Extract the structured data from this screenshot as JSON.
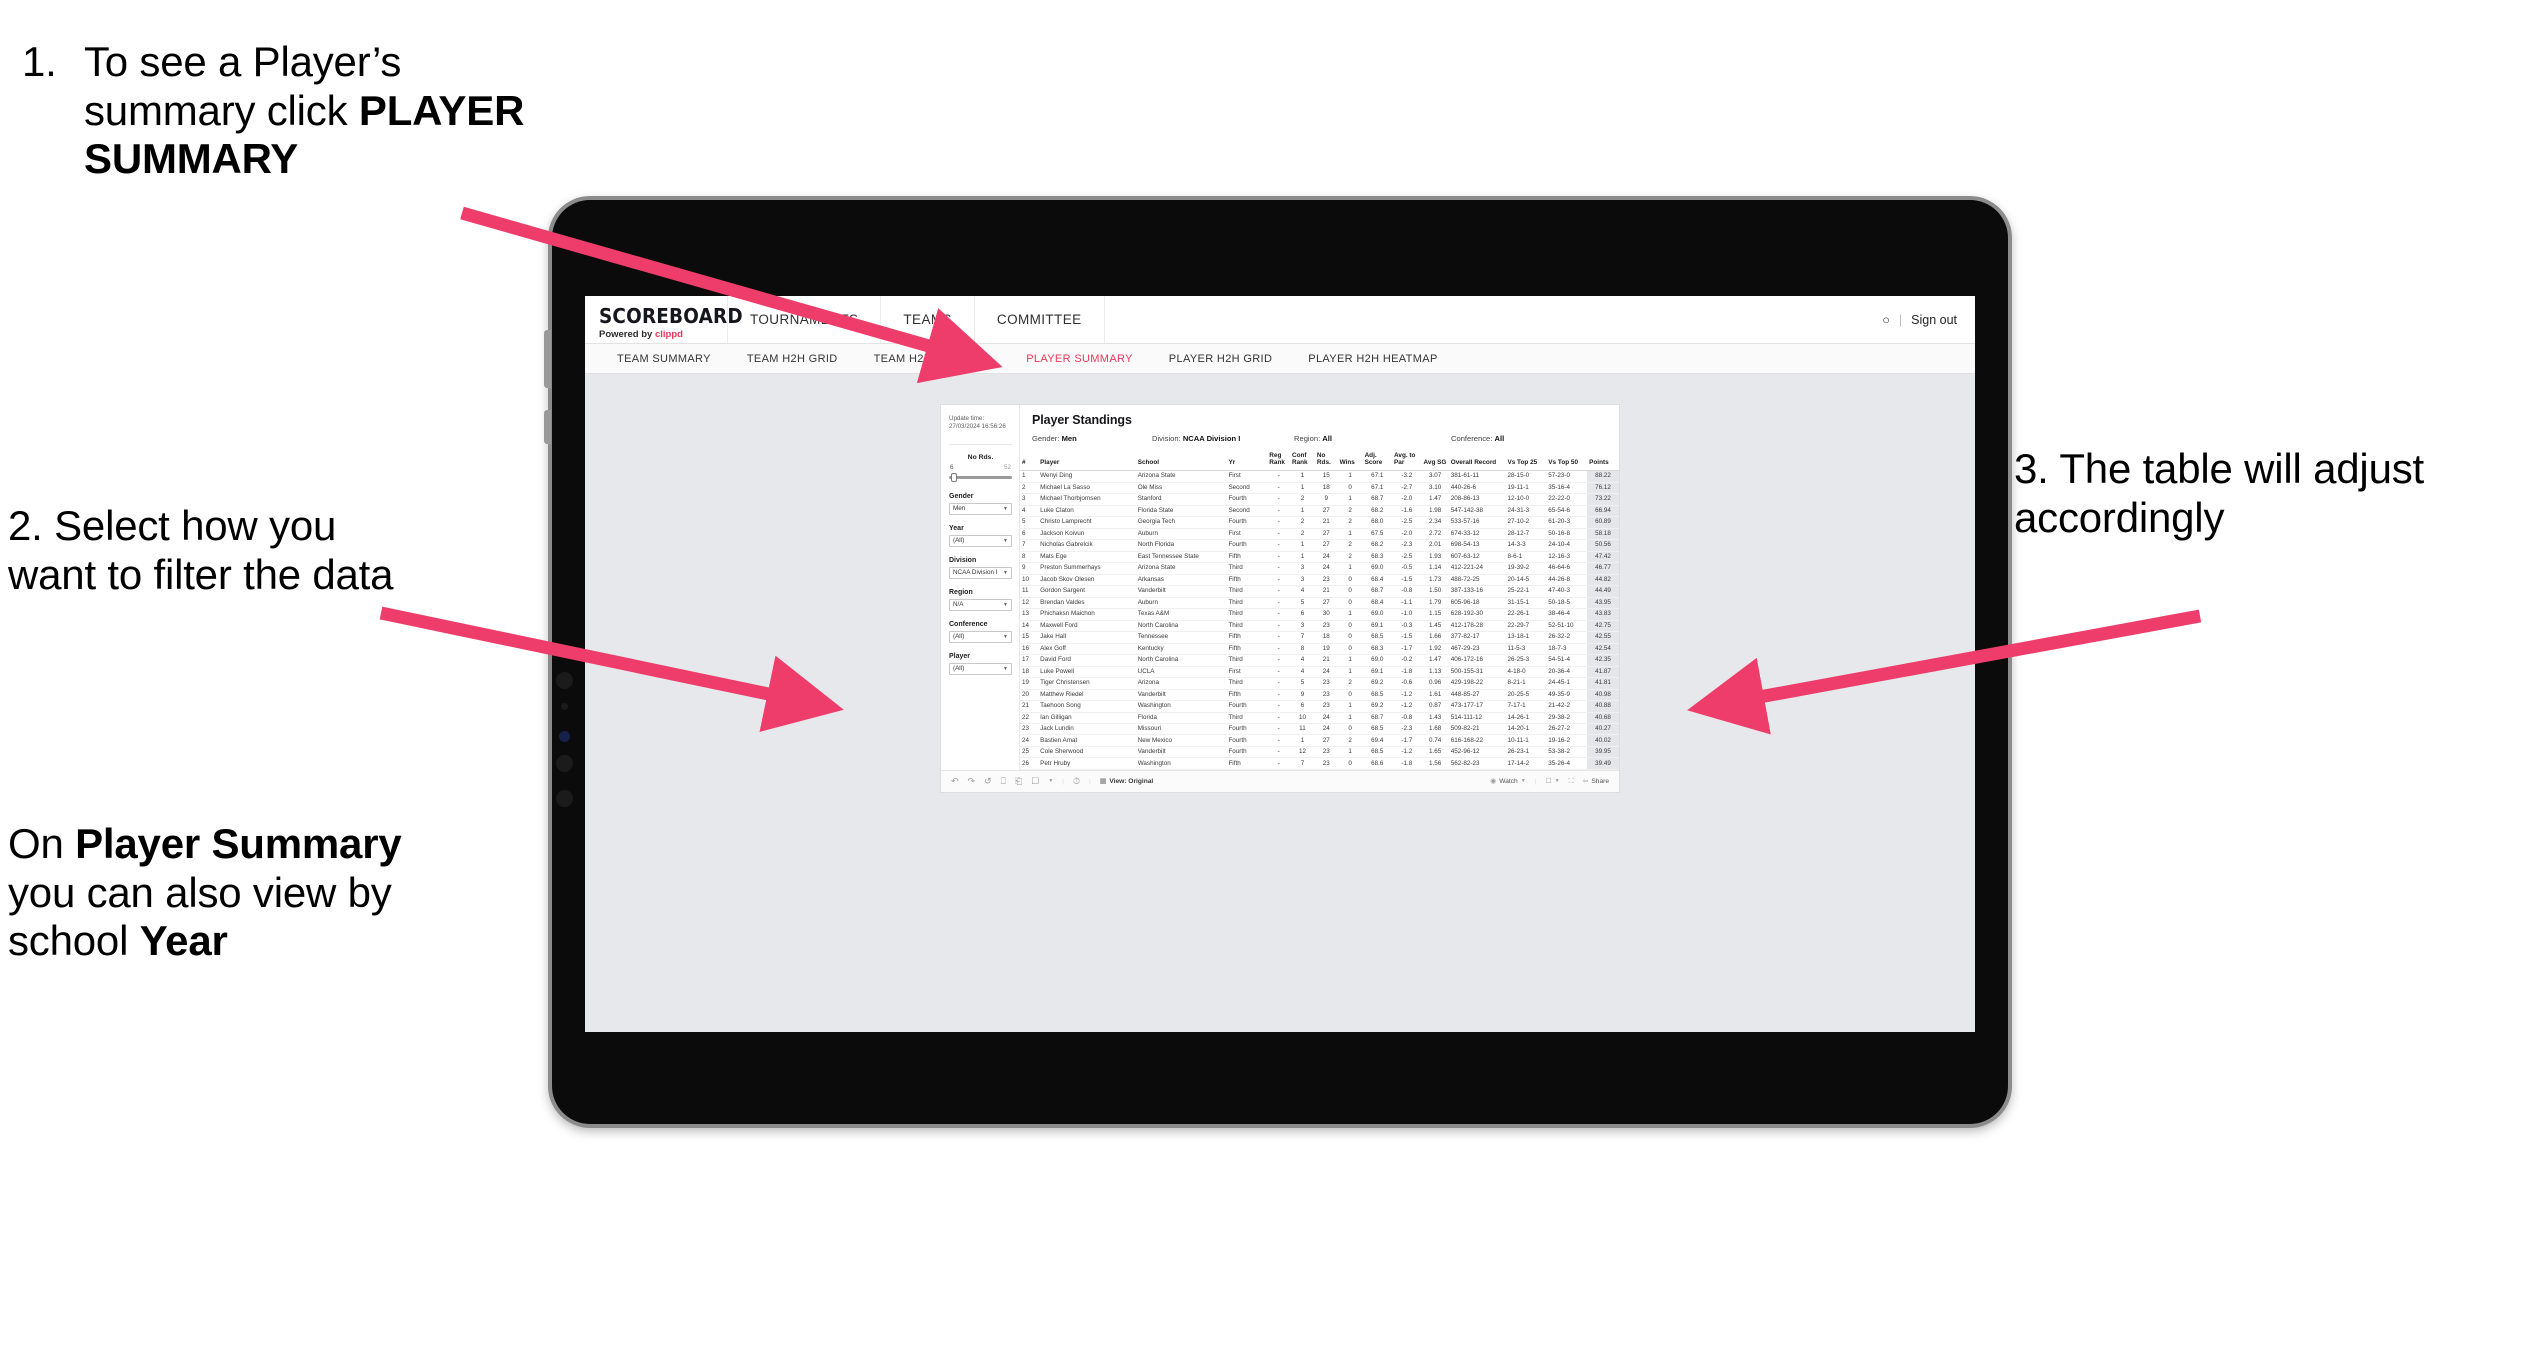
{
  "annotations": {
    "step1_number": "1.",
    "step1_text_before": "To see a Player’s summary click ",
    "step1_bold": "PLAYER SUMMARY",
    "step2_text": "2. Select how you want to filter the data",
    "step2b_pre": "On ",
    "step2b_bold1": "Player Summary",
    "step2b_mid": " you can also view by school ",
    "step2b_bold2": "Year",
    "step3_text": "3. The table will adjust accordingly"
  },
  "app": {
    "logo_main": "SCOREBOARD",
    "logo_sub_pre": "Powered by ",
    "logo_brand": "clippd",
    "nav": [
      {
        "label": "TOURNAMENTS"
      },
      {
        "label": "TEAMS"
      },
      {
        "label": "COMMITTEE"
      }
    ],
    "header_right": {
      "account_icon": "person-icon",
      "divider": "|",
      "sign_out": "Sign out"
    },
    "subnav": [
      {
        "label": "TEAM SUMMARY",
        "active": false
      },
      {
        "label": "TEAM H2H GRID",
        "active": false
      },
      {
        "label": "TEAM H2H HEATMAP",
        "active": false
      },
      {
        "label": "PLAYER SUMMARY",
        "active": true
      },
      {
        "label": "PLAYER H2H GRID",
        "active": false
      },
      {
        "label": "PLAYER H2H HEATMAP",
        "active": false
      }
    ]
  },
  "sheet": {
    "update_label": "Update time:",
    "update_value": "27/03/2024 16:56:26",
    "slider": {
      "title": "No Rds.",
      "min": "6",
      "max": "52"
    },
    "filters": [
      {
        "label": "Gender",
        "value": "Men"
      },
      {
        "label": "Year",
        "value": "(All)"
      },
      {
        "label": "Division",
        "value": "NCAA Division I"
      },
      {
        "label": "Region",
        "value": "N/A"
      },
      {
        "label": "Conference",
        "value": "(All)"
      },
      {
        "label": "Player",
        "value": "(All)"
      }
    ],
    "title": "Player Standings",
    "meta": [
      {
        "label": "Gender: ",
        "value": "Men"
      },
      {
        "label": "Division: ",
        "value": "NCAA Division I"
      },
      {
        "label": "Region: ",
        "value": "All"
      },
      {
        "label": "Conference: ",
        "value": "All"
      }
    ],
    "columns": [
      "#",
      "Player",
      "School",
      "Yr",
      "Reg Rank",
      "Conf Rank",
      "No Rds.",
      "Wins",
      "Adj. Score",
      "Avg. to Par",
      "Avg SG",
      "Overall Record",
      "Vs Top 25",
      "Vs Top 50",
      "Points"
    ],
    "rows": [
      [
        "1",
        "Wenyi Ding",
        "Arizona State",
        "First",
        "-",
        "1",
        "15",
        "1",
        "67.1",
        "-3.2",
        "3.07",
        "381-61-11",
        "28-15-0",
        "57-23-0",
        "88.22"
      ],
      [
        "2",
        "Michael La Sasso",
        "Ole Miss",
        "Second",
        "-",
        "1",
        "18",
        "0",
        "67.1",
        "-2.7",
        "3.10",
        "440-26-6",
        "19-11-1",
        "35-16-4",
        "76.12"
      ],
      [
        "3",
        "Michael Thorbjornsen",
        "Stanford",
        "Fourth",
        "-",
        "2",
        "9",
        "1",
        "68.7",
        "-2.0",
        "1.47",
        "208-86-13",
        "12-10-0",
        "22-22-0",
        "73.22"
      ],
      [
        "4",
        "Luke Claton",
        "Florida State",
        "Second",
        "-",
        "1",
        "27",
        "2",
        "68.2",
        "-1.6",
        "1.98",
        "547-142-38",
        "24-31-3",
        "65-54-6",
        "66.94"
      ],
      [
        "5",
        "Christo Lamprecht",
        "Georgia Tech",
        "Fourth",
        "-",
        "2",
        "21",
        "2",
        "68.0",
        "-2.5",
        "2.34",
        "533-57-16",
        "27-10-2",
        "61-20-3",
        "60.89"
      ],
      [
        "6",
        "Jackson Koivun",
        "Auburn",
        "First",
        "-",
        "2",
        "27",
        "1",
        "67.5",
        "-2.0",
        "2.72",
        "674-33-12",
        "28-12-7",
        "50-16-8",
        "58.18"
      ],
      [
        "7",
        "Nicholas Gabrelcik",
        "North Florida",
        "Fourth",
        "-",
        "1",
        "27",
        "2",
        "68.2",
        "-2.3",
        "2.01",
        "698-54-13",
        "14-3-3",
        "24-10-4",
        "50.56"
      ],
      [
        "8",
        "Mats Ege",
        "East Tennessee State",
        "Fifth",
        "-",
        "1",
        "24",
        "2",
        "68.3",
        "-2.5",
        "1.93",
        "607-63-12",
        "8-6-1",
        "12-16-3",
        "47.42"
      ],
      [
        "9",
        "Preston Summerhays",
        "Arizona State",
        "Third",
        "-",
        "3",
        "24",
        "1",
        "69.0",
        "-0.5",
        "1.14",
        "412-221-24",
        "19-39-2",
        "46-64-6",
        "46.77"
      ],
      [
        "10",
        "Jacob Skov Olesen",
        "Arkansas",
        "Fifth",
        "-",
        "3",
        "23",
        "0",
        "68.4",
        "-1.5",
        "1.73",
        "488-72-25",
        "20-14-5",
        "44-26-8",
        "44.82"
      ],
      [
        "11",
        "Gordon Sargent",
        "Vanderbilt",
        "Third",
        "-",
        "4",
        "21",
        "0",
        "68.7",
        "-0.8",
        "1.50",
        "387-133-16",
        "25-22-1",
        "47-40-3",
        "44.49"
      ],
      [
        "12",
        "Brendan Valdes",
        "Auburn",
        "Third",
        "-",
        "5",
        "27",
        "0",
        "68.4",
        "-1.1",
        "1.79",
        "605-96-18",
        "31-15-1",
        "50-18-5",
        "43.95"
      ],
      [
        "13",
        "Phichaksn Maichon",
        "Texas A&M",
        "Third",
        "-",
        "6",
        "30",
        "1",
        "69.0",
        "-1.0",
        "1.15",
        "628-192-30",
        "22-26-1",
        "38-46-4",
        "43.83"
      ],
      [
        "14",
        "Maxwell Ford",
        "North Carolina",
        "Third",
        "-",
        "3",
        "23",
        "0",
        "69.1",
        "-0.3",
        "1.45",
        "412-178-28",
        "22-29-7",
        "52-51-10",
        "42.75"
      ],
      [
        "15",
        "Jake Hall",
        "Tennessee",
        "Fifth",
        "-",
        "7",
        "18",
        "0",
        "68.5",
        "-1.5",
        "1.66",
        "377-82-17",
        "13-18-1",
        "26-32-2",
        "42.55"
      ],
      [
        "16",
        "Alex Goff",
        "Kentucky",
        "Fifth",
        "-",
        "8",
        "19",
        "0",
        "68.3",
        "-1.7",
        "1.92",
        "467-29-23",
        "11-5-3",
        "18-7-3",
        "42.54"
      ],
      [
        "17",
        "David Ford",
        "North Carolina",
        "Third",
        "-",
        "4",
        "21",
        "1",
        "69.0",
        "-0.2",
        "1.47",
        "406-172-16",
        "26-25-3",
        "54-51-4",
        "42.35"
      ],
      [
        "18",
        "Luke Powell",
        "UCLA",
        "First",
        "-",
        "4",
        "24",
        "1",
        "69.1",
        "-1.8",
        "1.13",
        "500-155-31",
        "4-18-0",
        "20-36-4",
        "41.87"
      ],
      [
        "19",
        "Tiger Christensen",
        "Arizona",
        "Third",
        "-",
        "5",
        "23",
        "2",
        "69.2",
        "-0.6",
        "0.96",
        "429-198-22",
        "8-21-1",
        "24-45-1",
        "41.81"
      ],
      [
        "20",
        "Matthew Riedel",
        "Vanderbilt",
        "Fifth",
        "-",
        "9",
        "23",
        "0",
        "68.5",
        "-1.2",
        "1.61",
        "448-85-27",
        "20-25-5",
        "49-35-9",
        "40.98"
      ],
      [
        "21",
        "Taehoon Song",
        "Washington",
        "Fourth",
        "-",
        "6",
        "23",
        "1",
        "69.2",
        "-1.2",
        "0.87",
        "473-177-17",
        "7-17-1",
        "21-42-2",
        "40.88"
      ],
      [
        "22",
        "Ian Gilligan",
        "Florida",
        "Third",
        "-",
        "10",
        "24",
        "1",
        "68.7",
        "-0.8",
        "1.43",
        "514-111-12",
        "14-26-1",
        "29-38-2",
        "40.68"
      ],
      [
        "23",
        "Jack Lundin",
        "Missouri",
        "Fourth",
        "-",
        "11",
        "24",
        "0",
        "68.5",
        "-2.3",
        "1.68",
        "509-82-21",
        "14-20-1",
        "26-27-2",
        "40.27"
      ],
      [
        "24",
        "Bastien Amat",
        "New Mexico",
        "Fourth",
        "-",
        "1",
        "27",
        "2",
        "69.4",
        "-1.7",
        "0.74",
        "616-168-22",
        "10-11-1",
        "19-16-2",
        "40.02"
      ],
      [
        "25",
        "Cole Sherwood",
        "Vanderbilt",
        "Fourth",
        "-",
        "12",
        "23",
        "1",
        "68.5",
        "-1.2",
        "1.65",
        "452-96-12",
        "26-23-1",
        "53-38-2",
        "39.95"
      ],
      [
        "26",
        "Petr Hruby",
        "Washington",
        "Fifth",
        "-",
        "7",
        "23",
        "0",
        "68.6",
        "-1.8",
        "1.56",
        "562-82-23",
        "17-14-2",
        "35-26-4",
        "39.49"
      ]
    ],
    "toolbar": {
      "undo_icon": "undo-icon",
      "redo_icon": "redo-icon",
      "revert_icon": "revert-icon",
      "refresh_icon": "refresh-icon",
      "pause_icon": "pause-icon",
      "alert_icon": "alert-icon",
      "caret_icon": "chevron-down-icon",
      "history_icon": "history-icon",
      "view_icon": "view-icon",
      "view_label": "View: Original",
      "watch_icon": "watch-icon",
      "watch_label": "Watch",
      "comment_icon": "comment-icon",
      "fullscreen_icon": "fullscreen-icon",
      "share_icon": "share-icon",
      "share_label": "Share"
    }
  },
  "colors": {
    "accent": "#e8375a",
    "arrow": "#ee3d6b",
    "screen_bg": "#e6e8eb",
    "bezel": "#0b0b0b",
    "frame": "#8c8c8c"
  }
}
